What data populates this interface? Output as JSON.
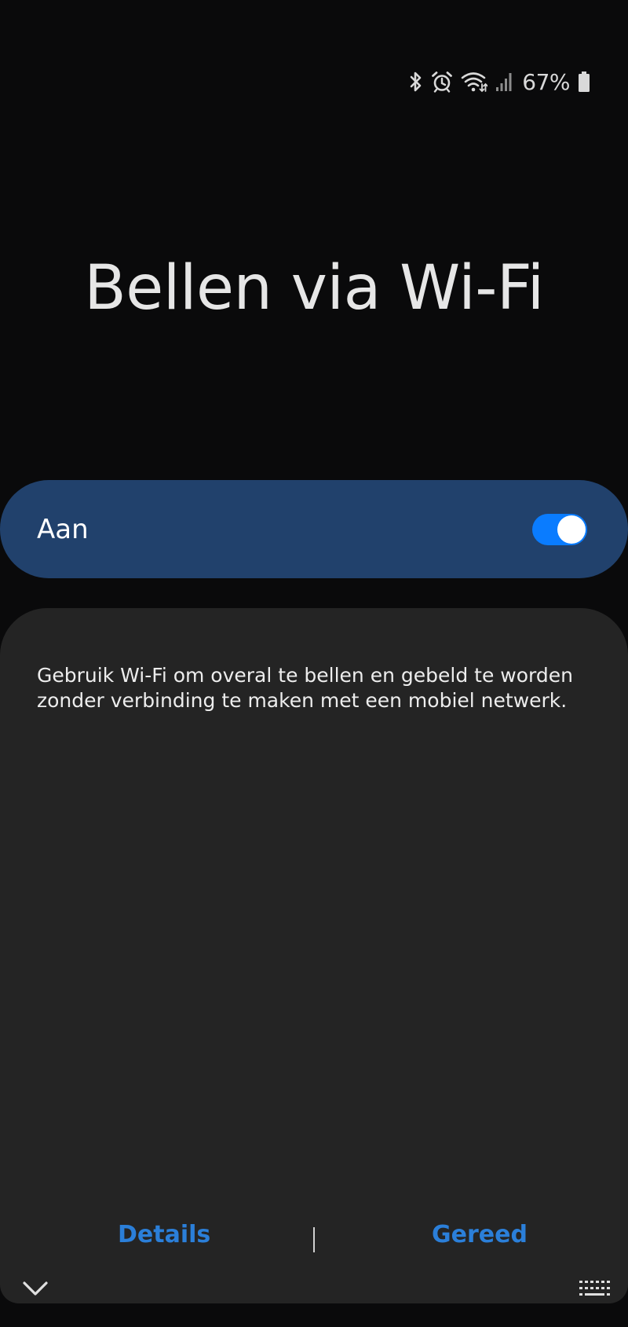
{
  "status_bar": {
    "icons": [
      "bluetooth-icon",
      "alarm-icon",
      "wifi-icon",
      "signal-icon",
      "battery-icon"
    ],
    "battery_percent": "67%"
  },
  "page": {
    "title": "Bellen via Wi-Fi"
  },
  "master_toggle": {
    "label": "Aan",
    "state": "on",
    "accent_color": "#0a7cff",
    "row_color": "#21416c"
  },
  "content": {
    "description": "Gebruik Wi-Fi om overal te bellen en gebeld te worden zonder verbinding te maken met een mobiel netwerk."
  },
  "actions": {
    "details_label": "Details",
    "done_label": "Gereed",
    "color": "#2b7fd9"
  },
  "nav": {
    "collapse_icon": "chevron-down-icon",
    "keyboard_icon": "keyboard-icon"
  }
}
